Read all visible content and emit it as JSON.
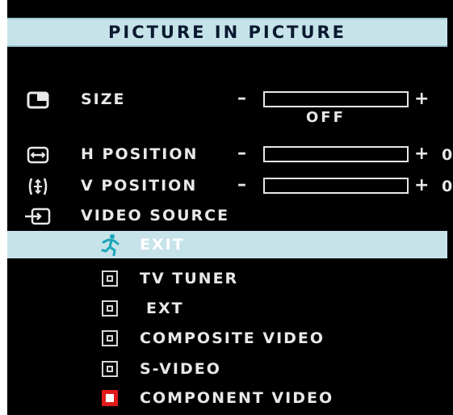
{
  "menu": {
    "title": "PICTURE IN PICTURE"
  },
  "settings": [
    {
      "label": "SIZE",
      "minus": "–",
      "plus": "+",
      "value": "",
      "status": "OFF",
      "icon": "size-icon"
    },
    {
      "label": "H POSITION",
      "minus": "–",
      "plus": "+",
      "value": "0",
      "icon": "h-position-icon"
    },
    {
      "label": "V POSITION",
      "minus": "–",
      "plus": "+",
      "value": "0",
      "icon": "v-position-icon"
    },
    {
      "label": "VIDEO SOURCE",
      "icon": "video-source-icon"
    }
  ],
  "sources": [
    {
      "label": "EXIT",
      "icon": "exit-icon",
      "state": "highlighted"
    },
    {
      "label": "TV TUNER",
      "icon": "checkbox-icon",
      "state": "off"
    },
    {
      "label": "EXT",
      "icon": "checkbox-icon",
      "state": "off"
    },
    {
      "label": "COMPOSITE VIDEO",
      "icon": "checkbox-icon",
      "state": "off"
    },
    {
      "label": "S-VIDEO",
      "icon": "checkbox-icon",
      "state": "off"
    },
    {
      "label": "COMPONENT VIDEO",
      "icon": "checkbox-icon",
      "state": "selected"
    }
  ],
  "colors": {
    "title_bar": "#c6e3ea",
    "background": "#000000",
    "text": "#e8e8e8",
    "selected_box": "#e11b1b",
    "highlight": "#c6e3ea",
    "exit_icon": "#1aa6b8"
  }
}
